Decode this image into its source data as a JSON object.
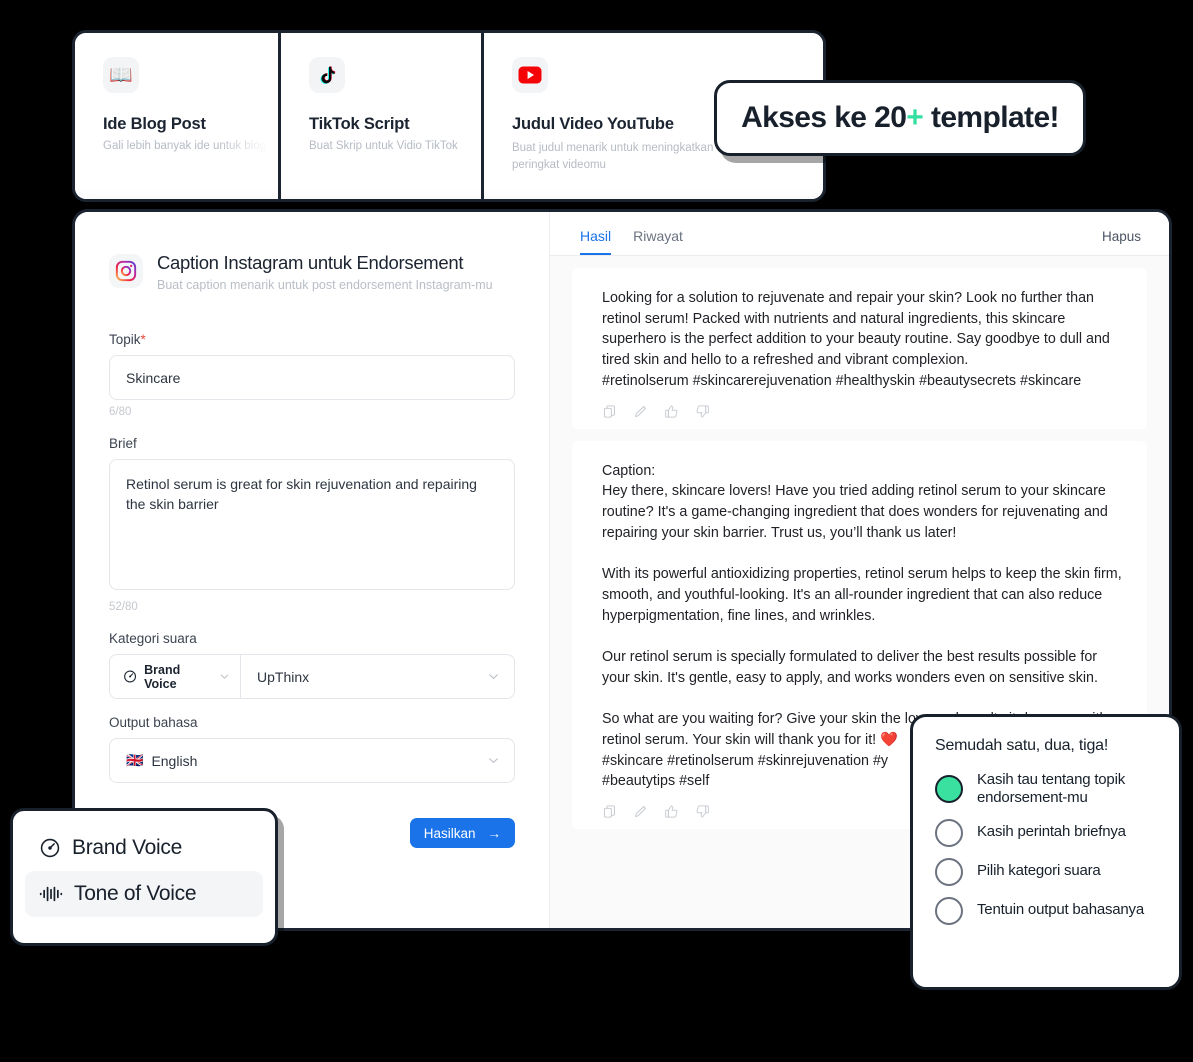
{
  "badge": {
    "prefix": "Akses ke 20",
    "plus": "+",
    "suffix": " template!",
    "plus_color": "#34e0a1"
  },
  "templates": [
    {
      "icon": "open-book-icon",
      "emoji": "📖",
      "title": "Ide Blog Post",
      "subtitle": "Gali lebih banyak ide untuk blog p"
    },
    {
      "icon": "tiktok-icon",
      "emoji": "",
      "title": "TikTok  Script",
      "subtitle": "Buat Skrip untuk Vidio TikTok"
    },
    {
      "icon": "youtube-icon",
      "emoji": "",
      "title": "Judul Video YouTube",
      "subtitle": "Buat judul menarik untuk meningkatkan peringkat videomu"
    }
  ],
  "form": {
    "icon": "instagram-icon",
    "title": "Caption Instagram untuk Endorsement",
    "subtitle": "Buat caption menarik untuk post endorsement Instagram-mu",
    "topic": {
      "label": "Topik",
      "required_mark": "*",
      "value": "Skincare",
      "placeholder": "Skincare",
      "counter": "6/80"
    },
    "brief": {
      "label": "Brief",
      "value": "Retinol serum is great for skin rejuvenation and repairing the skin barrier",
      "placeholder": "Retinol serum is great for skin rejuvenation and repairing the skin barrier",
      "counter": "52/80"
    },
    "voice_category": {
      "label": "Kategori suara",
      "type_value": "Brand Voice",
      "value": "UpThinx"
    },
    "output_language": {
      "label": "Output bahasa",
      "flag": "🇬🇧",
      "value": "English"
    },
    "generate_button": "Hasilkan",
    "generate_arrow": "→"
  },
  "results_panel": {
    "tabs": [
      {
        "label": "Hasil",
        "active": true
      },
      {
        "label": "Riwayat",
        "active": false
      }
    ],
    "clear_label": "Hapus",
    "cards": [
      {
        "text": "Looking for a solution to rejuvenate and repair your skin? Look no further than retinol serum! Packed with nutrients and natural ingredients, this skincare superhero is the perfect addition to your beauty routine. Say goodbye to dull and tired skin and hello to a refreshed and vibrant complexion.\n#retinolserum #skincarerejuvenation #healthyskin #beautysecrets #skincare"
      },
      {
        "text": "Caption:\nHey there, skincare lovers! Have you tried adding retinol serum to your skincare routine? It's a game-changing ingredient that does wonders for rejuvenating and repairing your skin barrier. Trust us, you’ll thank us later!\n\nWith its powerful antioxidizing properties, retinol serum helps to keep the skin firm, smooth, and youthful-looking. It's an all-rounder ingredient that can also reduce hyperpigmentation, fine lines, and wrinkles.\n\nOur retinol serum is specially formulated to deliver the best results possible for your skin. It's gentle, easy to apply, and works wonders even on sensitive skin.\n\nSo what are you waiting for? Give your skin the love and results it deserves with retinol serum. Your skin will thank you for it! ❤️\n#skincare #retinolserum #skinrejuvenation #y\n#beautytips #self"
      }
    ],
    "card_actions": [
      "copy-icon",
      "edit-icon",
      "thumbs-up-icon",
      "thumbs-down-icon"
    ]
  },
  "voice_menu": {
    "items": [
      {
        "label": "Brand Voice",
        "icon": "brand-voice-icon",
        "selected": false
      },
      {
        "label": "Tone of Voice",
        "icon": "tone-of-voice-icon",
        "selected": true
      }
    ]
  },
  "steps_card": {
    "title": "Semudah satu, dua, tiga!",
    "accent_color": "#3ae09f",
    "steps": [
      {
        "label": "Kasih tau tentang topik endorsement-mu",
        "done": true
      },
      {
        "label": "Kasih perintah briefnya",
        "done": false
      },
      {
        "label": "Pilih kategori suara",
        "done": false
      },
      {
        "label": "Tentuin output bahasanya",
        "done": false
      }
    ]
  }
}
